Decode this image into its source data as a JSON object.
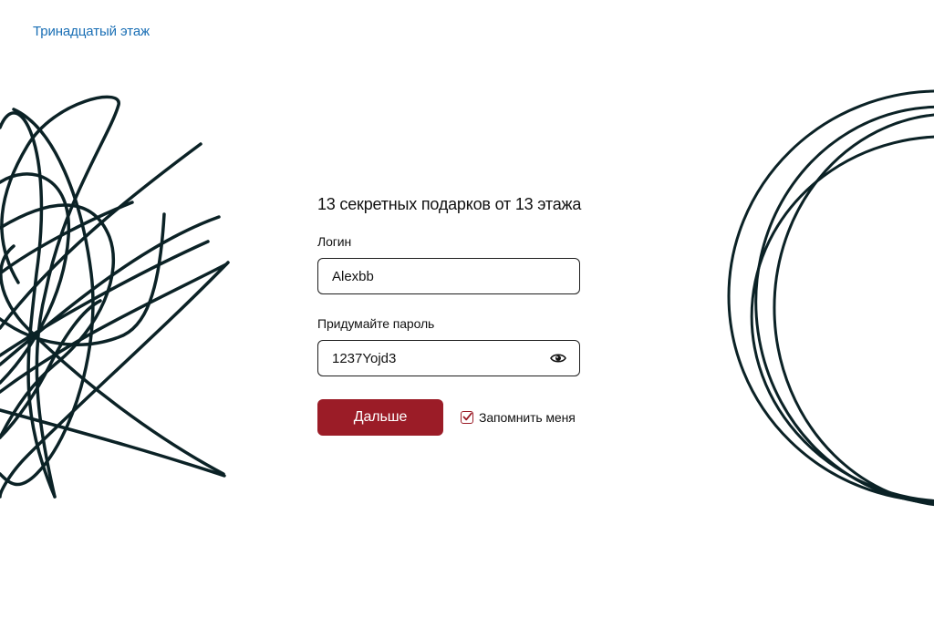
{
  "header": {
    "brand": "Тринадцатый этаж"
  },
  "form": {
    "title": "13 секретных подарков от 13 этажа",
    "login": {
      "label": "Логин",
      "value": "Alexbb"
    },
    "password": {
      "label": "Придумайте пароль",
      "value": "1237Yojd3",
      "toggle_icon": "eye-icon"
    },
    "submit_label": "Дальше",
    "remember": {
      "label": "Запомнить меня",
      "checked": true
    }
  },
  "colors": {
    "brand_link": "#1a6fb5",
    "primary_button": "#9b1c27",
    "scribble": "#0b2226"
  }
}
